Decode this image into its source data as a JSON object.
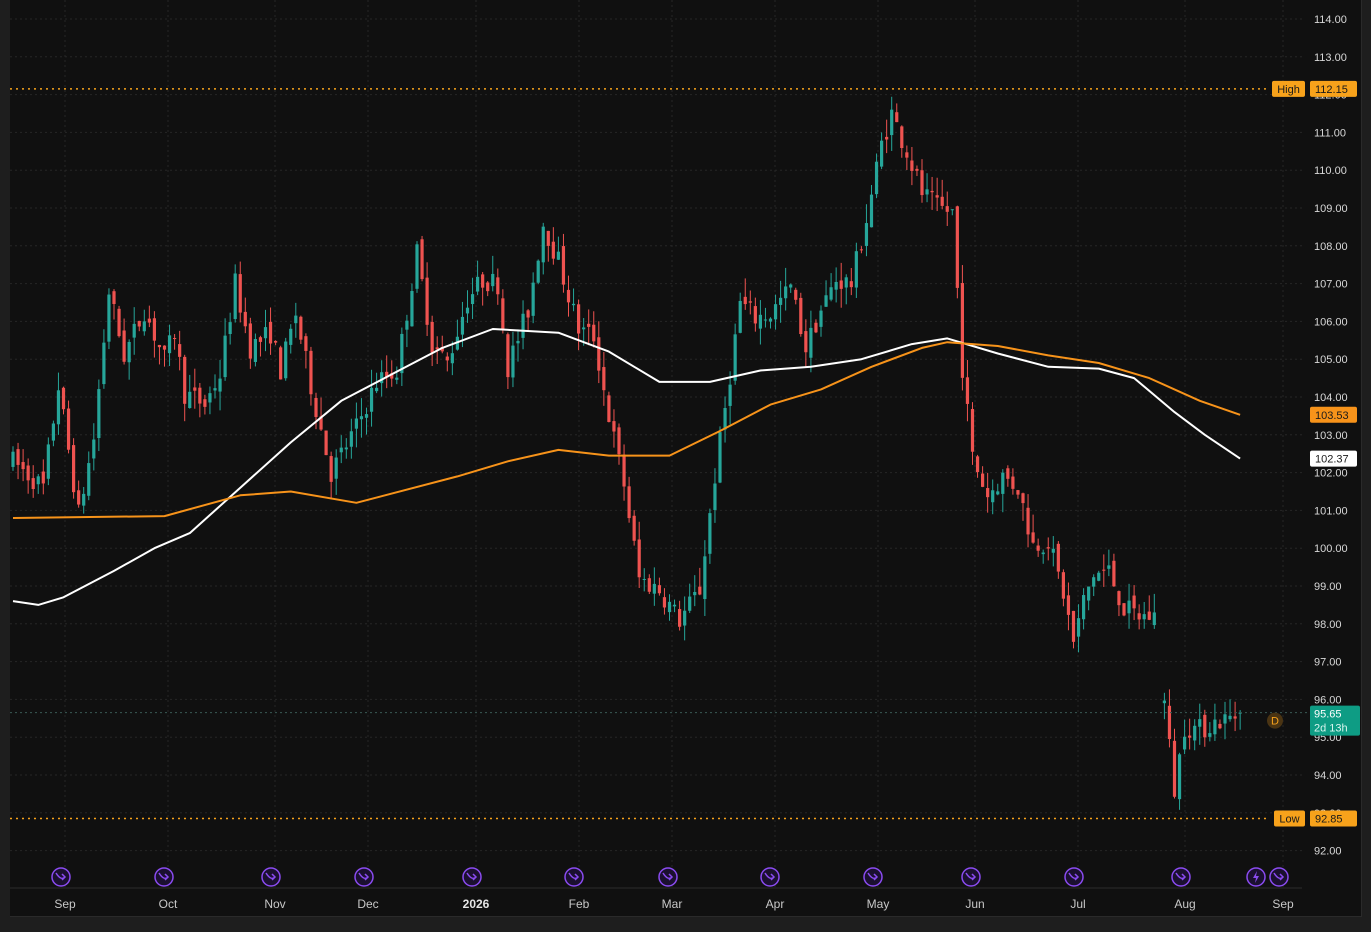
{
  "chart_data": {
    "type": "candlestick",
    "y_axis": {
      "ylim": [
        91.6,
        114.4
      ],
      "ticks": [
        "114.00",
        "113.00",
        "112.00",
        "111.00",
        "110.00",
        "109.00",
        "108.00",
        "107.00",
        "106.00",
        "105.00",
        "104.00",
        "103.00",
        "102.00",
        "101.00",
        "100.00",
        "99.00",
        "98.00",
        "97.00",
        "96.00",
        "95.00",
        "94.00",
        "93.00",
        "92.00"
      ],
      "grid": true,
      "position": "right"
    },
    "x_axis": {
      "labels": [
        {
          "label": "Sep",
          "bold": false
        },
        {
          "label": "Oct",
          "bold": false
        },
        {
          "label": "Nov",
          "bold": false
        },
        {
          "label": "Dec",
          "bold": false
        },
        {
          "label": "2026",
          "bold": true
        },
        {
          "label": "Feb",
          "bold": false
        },
        {
          "label": "Mar",
          "bold": false
        },
        {
          "label": "Apr",
          "bold": false
        },
        {
          "label": "May",
          "bold": false
        },
        {
          "label": "Jun",
          "bold": false
        },
        {
          "label": "Jul",
          "bold": false
        },
        {
          "label": "Aug",
          "bold": false
        },
        {
          "label": "Sep",
          "bold": false
        }
      ],
      "grid": true
    },
    "high_line": {
      "label": "High",
      "value": "112.15",
      "y": 112.15
    },
    "low_line": {
      "label": "Low",
      "value": "92.85",
      "y": 92.85
    },
    "last_price": {
      "value": "95.65",
      "countdown": "2d 13h",
      "y": 95.65
    },
    "ma_fast": {
      "color": "#f7931a",
      "last": "103.53",
      "y": 103.53
    },
    "ma_slow": {
      "color": "#ffffff",
      "last": "102.37",
      "y": 102.37
    },
    "marker_badge": "D",
    "price_path": [
      [
        0,
        102.3
      ],
      [
        6,
        101.6
      ],
      [
        9,
        104.3
      ],
      [
        13,
        100.9
      ],
      [
        16,
        102.9
      ],
      [
        19,
        106.8
      ],
      [
        22,
        105.1
      ],
      [
        26,
        106.3
      ],
      [
        30,
        105.0
      ],
      [
        32,
        105.7
      ],
      [
        34,
        104.1
      ],
      [
        38,
        103.8
      ],
      [
        41,
        104.6
      ],
      [
        44,
        107.0
      ],
      [
        47,
        105.3
      ],
      [
        51,
        105.7
      ],
      [
        53,
        104.7
      ],
      [
        56,
        106.2
      ],
      [
        59,
        104.3
      ],
      [
        63,
        102.0
      ],
      [
        68,
        103.2
      ],
      [
        72,
        104.4
      ],
      [
        76,
        104.7
      ],
      [
        80,
        107.8
      ],
      [
        83,
        105.4
      ],
      [
        86,
        104.9
      ],
      [
        90,
        106.6
      ],
      [
        93,
        107.1
      ],
      [
        96,
        107.0
      ],
      [
        98,
        104.8
      ],
      [
        102,
        106.3
      ],
      [
        105,
        108.6
      ],
      [
        108,
        107.6
      ],
      [
        112,
        105.8
      ],
      [
        115,
        105.6
      ],
      [
        118,
        103.5
      ],
      [
        121,
        101.7
      ],
      [
        124,
        99.2
      ],
      [
        128,
        98.9
      ],
      [
        132,
        98.1
      ],
      [
        136,
        98.9
      ],
      [
        139,
        101.9
      ],
      [
        142,
        104.6
      ],
      [
        144,
        106.5
      ],
      [
        147,
        106.1
      ],
      [
        150,
        106.2
      ],
      [
        154,
        106.9
      ],
      [
        157,
        105.3
      ],
      [
        160,
        106.3
      ],
      [
        163,
        107.1
      ],
      [
        166,
        107.0
      ],
      [
        169,
        108.7
      ],
      [
        172,
        110.7
      ],
      [
        174,
        111.5
      ],
      [
        177,
        110.5
      ],
      [
        180,
        109.4
      ],
      [
        183,
        109.0
      ],
      [
        186,
        108.9
      ],
      [
        188,
        104.8
      ],
      [
        190,
        102.4
      ],
      [
        193,
        101.4
      ],
      [
        196,
        101.9
      ],
      [
        199,
        101.6
      ],
      [
        202,
        100.1
      ],
      [
        205,
        100.2
      ],
      [
        208,
        98.8
      ],
      [
        210,
        97.5
      ],
      [
        212,
        98.6
      ],
      [
        214,
        99.3
      ],
      [
        217,
        99.4
      ],
      [
        220,
        98.4
      ],
      [
        223,
        98.2
      ],
      [
        226,
        98.2
      ],
      [
        228,
        95.9
      ],
      [
        230,
        93.6
      ],
      [
        232,
        95.3
      ],
      [
        235,
        95.2
      ],
      [
        238,
        95.4
      ],
      [
        241,
        95.5
      ],
      [
        243,
        95.65
      ]
    ],
    "fast_ma_path": [
      [
        0,
        100.8
      ],
      [
        30,
        100.85
      ],
      [
        45,
        101.4
      ],
      [
        55,
        101.5
      ],
      [
        68,
        101.2
      ],
      [
        88,
        101.9
      ],
      [
        98,
        102.3
      ],
      [
        108,
        102.6
      ],
      [
        118,
        102.45
      ],
      [
        130,
        102.45
      ],
      [
        140,
        103.1
      ],
      [
        150,
        103.8
      ],
      [
        160,
        104.2
      ],
      [
        170,
        104.8
      ],
      [
        180,
        105.3
      ],
      [
        185,
        105.45
      ],
      [
        195,
        105.35
      ],
      [
        205,
        105.1
      ],
      [
        215,
        104.9
      ],
      [
        225,
        104.5
      ],
      [
        235,
        103.9
      ],
      [
        243,
        103.53
      ]
    ],
    "slow_ma_path": [
      [
        0,
        98.6
      ],
      [
        5,
        98.5
      ],
      [
        10,
        98.7
      ],
      [
        20,
        99.4
      ],
      [
        28,
        100.0
      ],
      [
        35,
        100.4
      ],
      [
        45,
        101.6
      ],
      [
        55,
        102.8
      ],
      [
        65,
        103.9
      ],
      [
        75,
        104.6
      ],
      [
        85,
        105.3
      ],
      [
        95,
        105.8
      ],
      [
        108,
        105.7
      ],
      [
        118,
        105.2
      ],
      [
        128,
        104.4
      ],
      [
        138,
        104.4
      ],
      [
        148,
        104.7
      ],
      [
        158,
        104.8
      ],
      [
        168,
        105.0
      ],
      [
        178,
        105.4
      ],
      [
        185,
        105.55
      ],
      [
        195,
        105.15
      ],
      [
        205,
        104.8
      ],
      [
        215,
        104.75
      ],
      [
        222,
        104.5
      ],
      [
        230,
        103.6
      ],
      [
        236,
        103.0
      ],
      [
        243,
        102.37
      ]
    ]
  }
}
